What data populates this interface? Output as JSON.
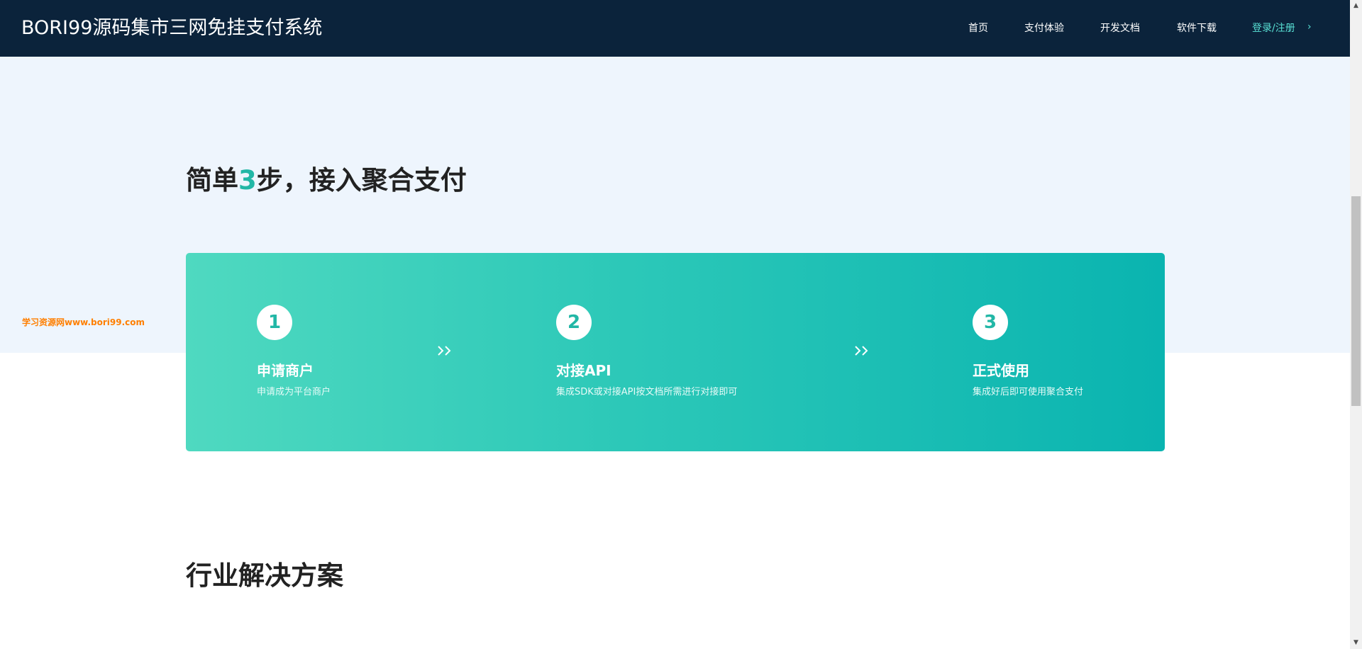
{
  "header": {
    "brand": "BORI99源码集市三网免挂支付系统",
    "nav": [
      {
        "label": "首页"
      },
      {
        "label": "支付体验"
      },
      {
        "label": "开发文档"
      },
      {
        "label": "软件下载"
      },
      {
        "label": "登录/注册"
      }
    ],
    "login_chevron": "›"
  },
  "steps_section": {
    "title_prefix": "简单",
    "title_number": "3",
    "title_suffix": "步，接入聚合支付",
    "steps": [
      {
        "number": "1",
        "title": "申请商户",
        "desc": "申请成为平台商户"
      },
      {
        "number": "2",
        "title": "对接API",
        "desc": "集成SDK或对接API按文档所需进行对接即可"
      },
      {
        "number": "3",
        "title": "正式使用",
        "desc": "集成好后即可使用聚合支付"
      }
    ]
  },
  "watermark": "学习资源网www.bori99.com",
  "solutions_section": {
    "title": "行业解决方案"
  },
  "colors": {
    "header_bg": "#0b233b",
    "accent": "#22b7a6",
    "login_link": "#58e0d4",
    "light_band": "#eef5fd",
    "watermark": "#ff7f00"
  },
  "icons": {
    "step_arrow": "double-chevron-right-icon",
    "scroll_up": "triangle-up-icon",
    "scroll_down": "triangle-down-icon",
    "login_chevron": "chevron-right-icon"
  }
}
